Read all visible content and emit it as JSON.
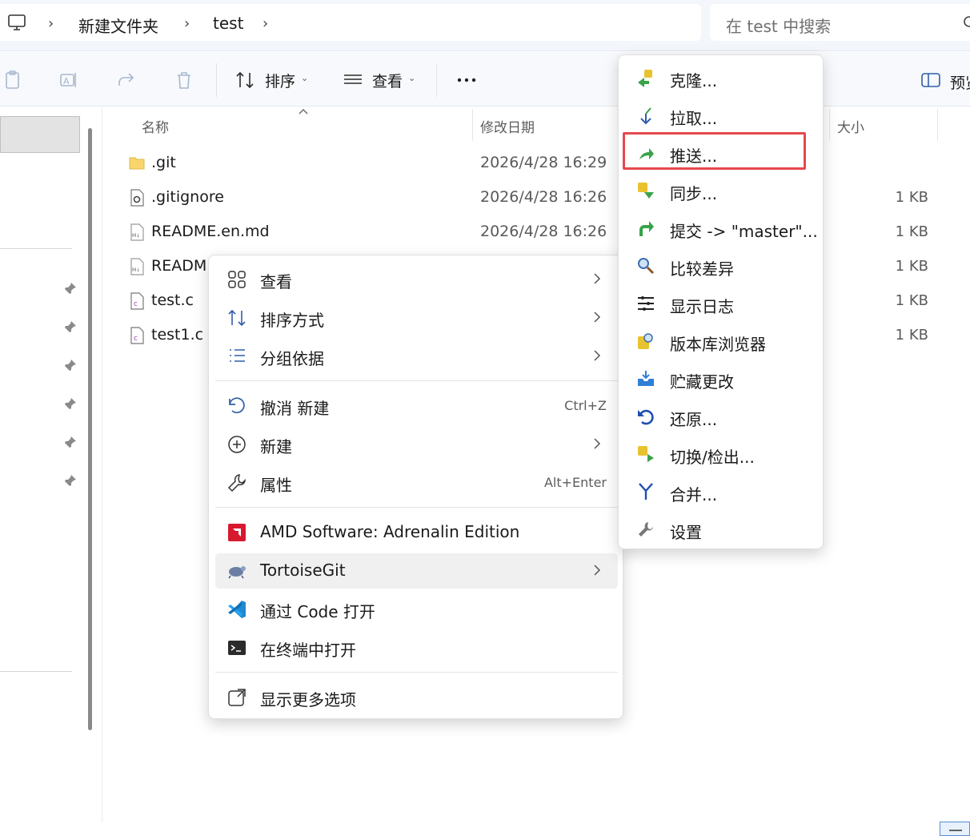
{
  "address_bar": {
    "crumbs": [
      "新建文件夹",
      "test"
    ],
    "search_placeholder": "在 test 中搜索"
  },
  "toolbar": {
    "sort_label": "排序",
    "view_label": "查看",
    "preview_label": "预览"
  },
  "columns": {
    "name": "名称",
    "date": "修改日期",
    "size": "大小"
  },
  "files": [
    {
      "name": ".git",
      "date": "2026/4/28 16:29",
      "size": "",
      "icon": "folder-icon"
    },
    {
      "name": ".gitignore",
      "date": "2026/4/28 16:26",
      "size": "1 KB",
      "icon": "settings-file-icon"
    },
    {
      "name": "README.en.md",
      "date": "2026/4/28 16:26",
      "size": "1 KB",
      "icon": "markdown-file-icon"
    },
    {
      "name": "READM",
      "date": "",
      "size": "1 KB",
      "icon": "markdown-file-icon"
    },
    {
      "name": "test.c",
      "date": "",
      "size": "1 KB",
      "icon": "c-file-icon"
    },
    {
      "name": "test1.c",
      "date": "",
      "size": "1 KB",
      "icon": "c-file-icon"
    }
  ],
  "context_menu": {
    "items": [
      {
        "label": "查看",
        "shortcut": "",
        "submenu": true,
        "icon": "view-grid-icon"
      },
      {
        "label": "排序方式",
        "shortcut": "",
        "submenu": true,
        "icon": "sort-icon"
      },
      {
        "label": "分组依据",
        "shortcut": "",
        "submenu": true,
        "icon": "group-list-icon"
      },
      {
        "label": "撤消 新建",
        "shortcut": "Ctrl+Z",
        "submenu": false,
        "icon": "undo-icon"
      },
      {
        "label": "新建",
        "shortcut": "",
        "submenu": true,
        "icon": "new-plus-icon"
      },
      {
        "label": "属性",
        "shortcut": "Alt+Enter",
        "submenu": false,
        "icon": "wrench-icon"
      },
      {
        "label": "AMD Software: Adrenalin Edition",
        "shortcut": "",
        "submenu": false,
        "icon": "amd-logo-icon"
      },
      {
        "label": "TortoiseGit",
        "shortcut": "",
        "submenu": true,
        "icon": "tortoisegit-icon"
      },
      {
        "label": "通过 Code 打开",
        "shortcut": "",
        "submenu": false,
        "icon": "vscode-icon"
      },
      {
        "label": "在终端中打开",
        "shortcut": "",
        "submenu": false,
        "icon": "terminal-icon"
      },
      {
        "label": "显示更多选项",
        "shortcut": "",
        "submenu": false,
        "icon": "more-options-icon"
      }
    ]
  },
  "tortoisegit_menu": {
    "items": [
      {
        "label": "克隆...",
        "icon": "clone-icon"
      },
      {
        "label": "拉取...",
        "icon": "pull-icon"
      },
      {
        "label": "推送...",
        "icon": "push-icon"
      },
      {
        "label": "同步...",
        "icon": "sync-icon"
      },
      {
        "label": "提交 -> \"master\"...",
        "icon": "commit-icon"
      },
      {
        "label": "比较差异",
        "icon": "diff-magnifier-icon"
      },
      {
        "label": "显示日志",
        "icon": "log-icon"
      },
      {
        "label": "版本库浏览器",
        "icon": "repo-browser-icon"
      },
      {
        "label": "贮藏更改",
        "icon": "stash-icon"
      },
      {
        "label": "还原...",
        "icon": "revert-icon"
      },
      {
        "label": "切换/检出...",
        "icon": "switch-icon"
      },
      {
        "label": "合并...",
        "icon": "merge-icon"
      },
      {
        "label": "设置",
        "icon": "settings-wrench-icon"
      }
    ]
  }
}
